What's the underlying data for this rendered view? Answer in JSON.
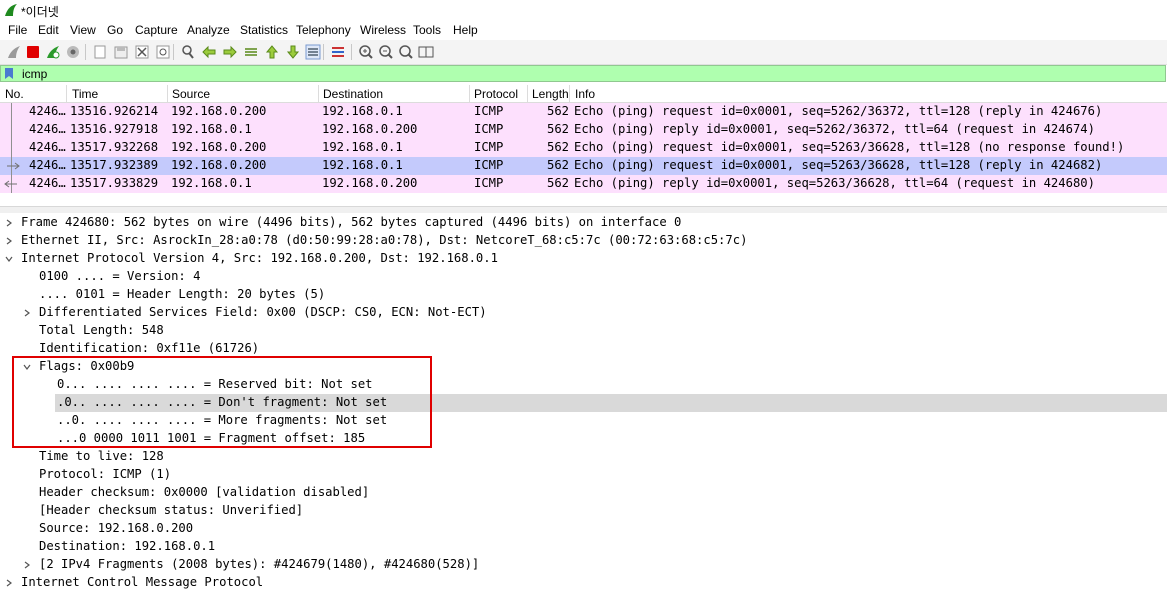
{
  "window": {
    "title": "*이더넷"
  },
  "menu": [
    "File",
    "Edit",
    "View",
    "Go",
    "Capture",
    "Analyze",
    "Statistics",
    "Telephony",
    "Wireless",
    "Tools",
    "Help"
  ],
  "toolbar_icons": [
    "shark-fin-start-icon",
    "stop-capture-icon",
    "restart-capture-icon",
    "capture-options-icon",
    "open-file-icon",
    "save-file-icon",
    "close-file-icon",
    "reload-file-icon",
    "find-packet-icon",
    "go-back-icon",
    "go-forward-icon",
    "go-to-packet-icon",
    "go-first-icon",
    "go-last-icon",
    "autoscroll-icon",
    "colorize-icon",
    "zoom-in-icon",
    "zoom-out-icon",
    "zoom-normal-icon",
    "resize-columns-icon"
  ],
  "filter": {
    "value": "icmp"
  },
  "packet_list": {
    "columns": [
      "No.",
      "Time",
      "Source",
      "Destination",
      "Protocol",
      "Length",
      "Info"
    ],
    "rows": [
      {
        "no": "4246…",
        "time": "13516.926214",
        "source": "192.168.0.200",
        "destination": "192.168.0.1",
        "protocol": "ICMP",
        "length": "562",
        "info": "Echo (ping) request  id=0x0001, seq=5262/36372, ttl=128 (reply in 424676)",
        "selected": false,
        "relation": "request"
      },
      {
        "no": "4246…",
        "time": "13516.927918",
        "source": "192.168.0.1",
        "destination": "192.168.0.200",
        "protocol": "ICMP",
        "length": "562",
        "info": "Echo (ping) reply    id=0x0001, seq=5262/36372, ttl=64 (request in 424674)",
        "selected": false,
        "relation": "none"
      },
      {
        "no": "4246…",
        "time": "13517.932268",
        "source": "192.168.0.200",
        "destination": "192.168.0.1",
        "protocol": "ICMP",
        "length": "562",
        "info": "Echo (ping) request  id=0x0001, seq=5263/36628, ttl=128 (no response found!)",
        "selected": false,
        "relation": "none"
      },
      {
        "no": "4246…",
        "time": "13517.932389",
        "source": "192.168.0.200",
        "destination": "192.168.0.1",
        "protocol": "ICMP",
        "length": "562",
        "info": "Echo (ping) request  id=0x0001, seq=5263/36628, ttl=128 (reply in 424682)",
        "selected": true,
        "relation": "request"
      },
      {
        "no": "4246…",
        "time": "13517.933829",
        "source": "192.168.0.1",
        "destination": "192.168.0.200",
        "protocol": "ICMP",
        "length": "562",
        "info": "Echo (ping) reply    id=0x0001, seq=5263/36628, ttl=64 (request in 424680)",
        "selected": false,
        "relation": "reply"
      }
    ]
  },
  "details": [
    {
      "indent": 0,
      "twisty": "collapsed",
      "text": "Frame 424680: 562 bytes on wire (4496 bits), 562 bytes captured (4496 bits) on interface 0"
    },
    {
      "indent": 0,
      "twisty": "collapsed",
      "text": "Ethernet II, Src: AsrockIn_28:a0:78 (d0:50:99:28:a0:78), Dst: NetcoreT_68:c5:7c (00:72:63:68:c5:7c)"
    },
    {
      "indent": 0,
      "twisty": "expanded",
      "text": "Internet Protocol Version 4, Src: 192.168.0.200, Dst: 192.168.0.1"
    },
    {
      "indent": 1,
      "twisty": "none",
      "text": "0100 .... = Version: 4"
    },
    {
      "indent": 1,
      "twisty": "none",
      "text": ".... 0101 = Header Length: 20 bytes (5)"
    },
    {
      "indent": 1,
      "twisty": "collapsed",
      "text": "Differentiated Services Field: 0x00 (DSCP: CS0, ECN: Not-ECT)"
    },
    {
      "indent": 1,
      "twisty": "none",
      "text": "Total Length: 548"
    },
    {
      "indent": 1,
      "twisty": "none",
      "text": "Identification: 0xf11e (61726)"
    },
    {
      "indent": 1,
      "twisty": "expanded",
      "text": "Flags: 0x00b9"
    },
    {
      "indent": 2,
      "twisty": "none",
      "text": "0... .... .... .... = Reserved bit: Not set"
    },
    {
      "indent": 2,
      "twisty": "none",
      "text": ".0.. .... .... .... = Don't fragment: Not set",
      "highlighted": true
    },
    {
      "indent": 2,
      "twisty": "none",
      "text": "..0. .... .... .... = More fragments: Not set"
    },
    {
      "indent": 2,
      "twisty": "none",
      "text": "...0 0000 1011 1001 = Fragment offset: 185"
    },
    {
      "indent": 1,
      "twisty": "none",
      "text": "Time to live: 128"
    },
    {
      "indent": 1,
      "twisty": "none",
      "text": "Protocol: ICMP (1)"
    },
    {
      "indent": 1,
      "twisty": "none",
      "text": "Header checksum: 0x0000 [validation disabled]"
    },
    {
      "indent": 1,
      "twisty": "none",
      "text": "[Header checksum status: Unverified]"
    },
    {
      "indent": 1,
      "twisty": "none",
      "text": "Source: 192.168.0.200"
    },
    {
      "indent": 1,
      "twisty": "none",
      "text": "Destination: 192.168.0.1"
    },
    {
      "indent": 1,
      "twisty": "collapsed",
      "text": "[2 IPv4 Fragments (2008 bytes): #424679(1480), #424680(528)]"
    },
    {
      "indent": 0,
      "twisty": "collapsed",
      "text": "Internet Control Message Protocol"
    }
  ],
  "colors": {
    "row_pink": "#fde0fd",
    "row_selected": "#c4cafc",
    "filter_green": "#afffaf",
    "annotation_red": "#e00000",
    "stop_red": "#e00000"
  }
}
